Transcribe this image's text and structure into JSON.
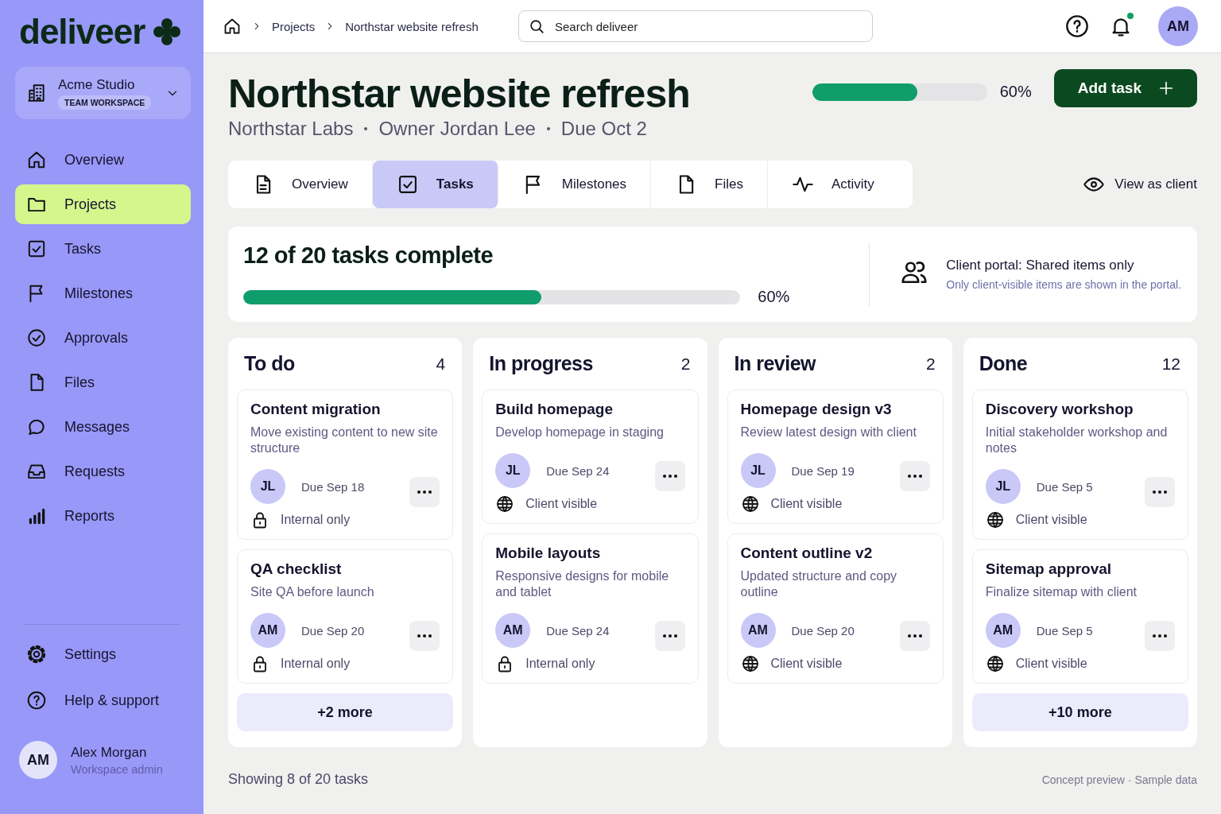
{
  "sidebar": {
    "logo": "deliveer",
    "workspace": {
      "name": "Acme Studio",
      "badge": "TEAM WORKSPACE"
    },
    "nav": [
      {
        "label": "Overview",
        "selected": false
      },
      {
        "label": "Projects",
        "selected": true
      },
      {
        "label": "Tasks",
        "selected": false
      },
      {
        "label": "Milestones",
        "selected": false
      },
      {
        "label": "Approvals",
        "selected": false
      },
      {
        "label": "Files",
        "selected": false
      },
      {
        "label": "Messages",
        "selected": false
      },
      {
        "label": "Requests",
        "selected": false
      },
      {
        "label": "Reports",
        "selected": false
      }
    ],
    "bottom": [
      "Settings",
      "Help & support"
    ],
    "user": {
      "initials": "AM",
      "name": "Alex Morgan",
      "role": "Workspace admin"
    }
  },
  "topbar": {
    "breadcrumb": [
      "Projects",
      "Northstar website refresh"
    ],
    "search": {
      "placeholder": "Search deliveer"
    },
    "notifications_unread": true,
    "avatar": "AM"
  },
  "project": {
    "title": "Northstar website refresh",
    "meta": [
      "Northstar Labs",
      "Owner Jordan Lee",
      "Due Oct 2"
    ],
    "level": 0.6,
    "reading": "60%",
    "add_button": "Add task"
  },
  "tabs": [
    {
      "label": "Overview",
      "selected": false
    },
    {
      "label": "Tasks",
      "selected": true
    },
    {
      "label": "Milestones",
      "selected": false
    },
    {
      "label": "Files",
      "selected": false
    },
    {
      "label": "Activity",
      "selected": false
    }
  ],
  "view_as_client": "View as client",
  "summary": {
    "title": "12 of 20 tasks complete",
    "level": 0.6,
    "reading": "60%",
    "portal_title": "Client portal: Shared items only",
    "portal_note": "Only client-visible items are shown in the portal."
  },
  "columns": [
    {
      "name": "To do",
      "count": "4",
      "more": "+2 more",
      "cards": [
        {
          "title": "Content migration",
          "description": "Move existing content to new site structure",
          "assignee": "JL",
          "due": "Due Sep 18",
          "kind": "internal",
          "visibility": "Internal only"
        },
        {
          "title": "QA checklist",
          "description": "Site QA before launch",
          "assignee": "AM",
          "due": "Due Sep 20",
          "kind": "internal",
          "visibility": "Internal only"
        }
      ]
    },
    {
      "name": "In progress",
      "count": "2",
      "cards": [
        {
          "title": "Build homepage",
          "description": "Develop homepage in staging",
          "assignee": "JL",
          "due": "Due Sep 24",
          "kind": "client",
          "visibility": "Client visible"
        },
        {
          "title": "Mobile layouts",
          "description": "Responsive designs for mobile and tablet",
          "assignee": "AM",
          "due": "Due Sep 24",
          "kind": "internal",
          "visibility": "Internal only"
        }
      ]
    },
    {
      "name": "In review",
      "count": "2",
      "cards": [
        {
          "title": "Homepage design v3",
          "description": "Review latest design with client",
          "assignee": "JL",
          "due": "Due Sep 19",
          "kind": "client",
          "visibility": "Client visible"
        },
        {
          "title": "Content outline v2",
          "description": "Updated structure and copy outline",
          "assignee": "AM",
          "due": "Due Sep 20",
          "kind": "client",
          "visibility": "Client visible"
        }
      ]
    },
    {
      "name": "Done",
      "count": "12",
      "more": "+10 more",
      "cards": [
        {
          "title": "Discovery workshop",
          "description": "Initial stakeholder workshop and notes",
          "assignee": "JL",
          "due": "Due Sep 5",
          "kind": "client",
          "visibility": "Client visible"
        },
        {
          "title": "Sitemap approval",
          "description": "Finalize sitemap with client",
          "assignee": "AM",
          "due": "Due Sep 5",
          "kind": "client",
          "visibility": "Client visible"
        }
      ]
    }
  ],
  "footer": {
    "showing": "Showing 8 of 20 tasks",
    "note": "Concept preview · Sample data"
  }
}
